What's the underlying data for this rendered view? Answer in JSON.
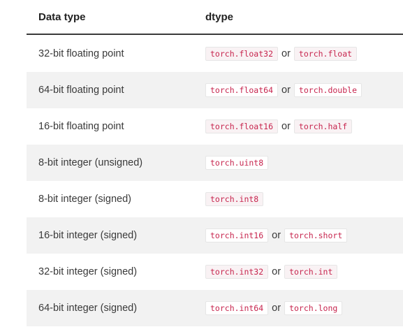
{
  "header": {
    "col1": "Data type",
    "col2": "dtype"
  },
  "rows": [
    {
      "type": "32-bit floating point",
      "dtype1": "torch.float32",
      "or": "or",
      "dtype2": "torch.float"
    },
    {
      "type": "64-bit floating point",
      "dtype1": "torch.float64",
      "or": "or",
      "dtype2": "torch.double"
    },
    {
      "type": "16-bit floating point",
      "dtype1": "torch.float16",
      "or": "or",
      "dtype2": "torch.half"
    },
    {
      "type": "8-bit integer (unsigned)",
      "dtype1": "torch.uint8"
    },
    {
      "type": "8-bit integer (signed)",
      "dtype1": "torch.int8"
    },
    {
      "type": "16-bit integer (signed)",
      "dtype1": "torch.int16",
      "or": "or",
      "dtype2": "torch.short"
    },
    {
      "type": "32-bit integer (signed)",
      "dtype1": "torch.int32",
      "or": "or",
      "dtype2": "torch.int"
    },
    {
      "type": "64-bit integer (signed)",
      "dtype1": "torch.int64",
      "or": "or",
      "dtype2": "torch.long"
    }
  ],
  "colors": {
    "code_text": "#c7254e",
    "row_shade": "#f2f2f2",
    "header_rule": "#3a3a3a"
  }
}
